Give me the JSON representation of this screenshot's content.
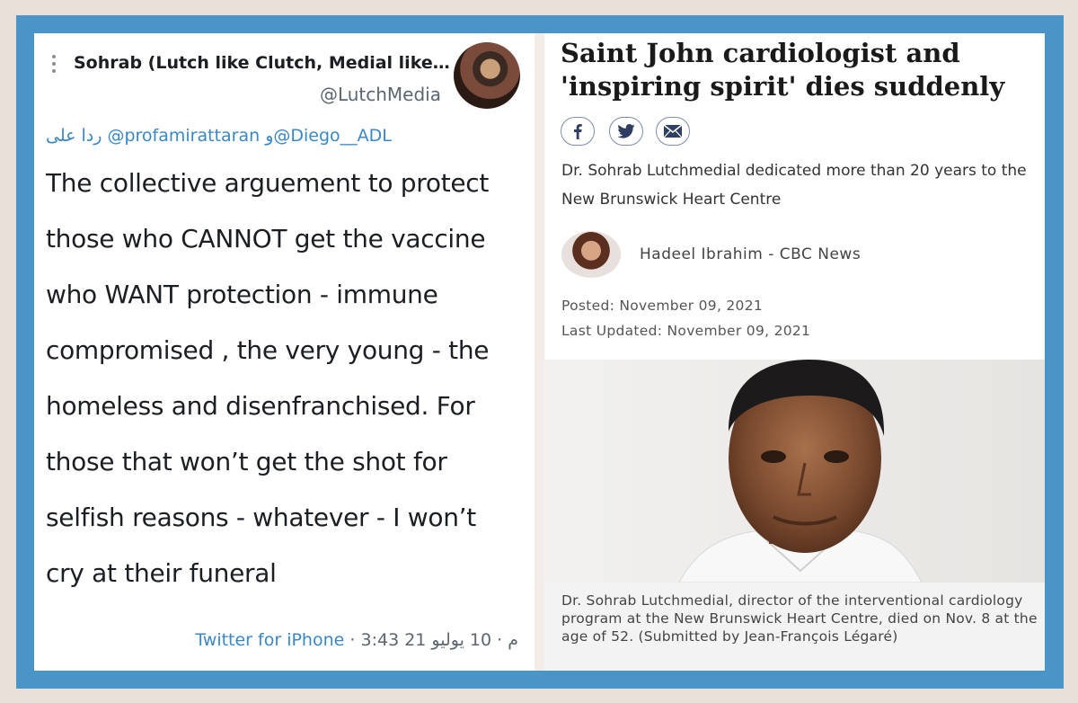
{
  "tweet": {
    "author_name": "Sohrab (Lutch like Clutch, Medial like ...",
    "author_handle": "@LutchMedia",
    "reply_to": "ردا على @profamirattaran و@Diego__ADL",
    "text_lines": [
      "The collective arguement to protect",
      "those who CANNOT get the vaccine",
      "who WANT protection - immune",
      "compromised , the very young - the",
      "homeless and disenfranchised.   For",
      "those that won’t get the shot for",
      "selfish reasons - whatever - I won’t",
      "cry at their funeral"
    ],
    "meta_time_date": "3:43 م · 10 يوليو 21",
    "meta_source": "Twitter for iPhone"
  },
  "article": {
    "headline": "Saint John cardiologist and 'inspiring spirit' dies suddenly",
    "share_icons": [
      "facebook-icon",
      "twitter-icon",
      "email-icon"
    ],
    "deck": "Dr. Sohrab Lutchmedial dedicated more than 20 years to the New Brunswick Heart Centre",
    "byline": "Hadeel Ibrahim - CBC News",
    "posted": "Posted: November 09, 2021",
    "last_updated": "Last Updated: November 09, 2021",
    "caption": "Dr. Sohrab Lutchmedial, director of the interventional cardiology program at the New Brunswick Heart Centre, died on Nov. 8 at the age of 52. (Submitted by  Jean-François Légaré)"
  },
  "colors": {
    "frame": "#4a94c8",
    "link": "#3b87c6",
    "background": "#e8dfd8"
  }
}
